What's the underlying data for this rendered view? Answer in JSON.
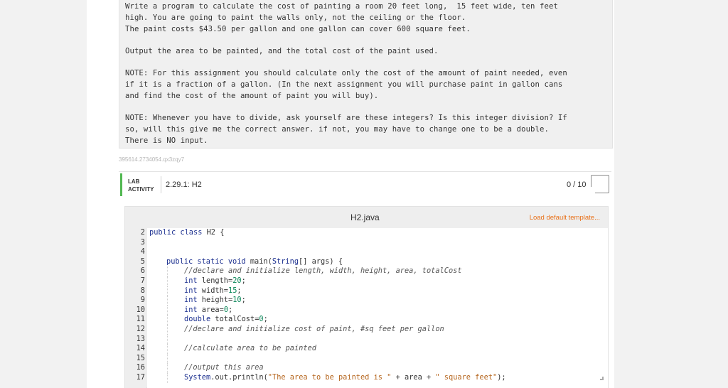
{
  "instructions": {
    "lines1": [
      "Write a program to calculate the cost of painting a room 20 feet long,  15 feet wide, ten feet",
      "high. You are going to paint the walls only, not the ceiling or the floor.",
      "The paint costs $43.50 per gallon and one gallon can cover 600 square feet."
    ],
    "lines2": [
      "Output the area to be painted, and the total cost of the paint used."
    ],
    "lines3": [
      "NOTE: For this assignment you should calculate only the cost of the amount of paint needed, even",
      "if it is a fraction of a gallon. (In the next assignment you will purchase paint in gallon cans",
      "and find the cost of the amount of paint you will buy)."
    ],
    "lines4": [
      "NOTE: Whenever you have to divide, ask yourself are these integers? Is this integer division? If",
      "so, will this give me the correct answer. if not, you may have to change one to be a double.",
      "There is NO input."
    ]
  },
  "activity_id": "395614.2734054.qx3zqy7",
  "lab": {
    "tag_line1": "LAB",
    "tag_line2": "ACTIVITY",
    "title": "2.29.1: H2",
    "score": "0 / 10"
  },
  "editor": {
    "filename": "H2.java",
    "load_default": "Load default template...",
    "line_numbers": [
      "2",
      "3",
      "4",
      "5",
      "6",
      "7",
      "8",
      "9",
      "10",
      "11",
      "12",
      "13",
      "14",
      "15",
      "16",
      "17"
    ]
  }
}
